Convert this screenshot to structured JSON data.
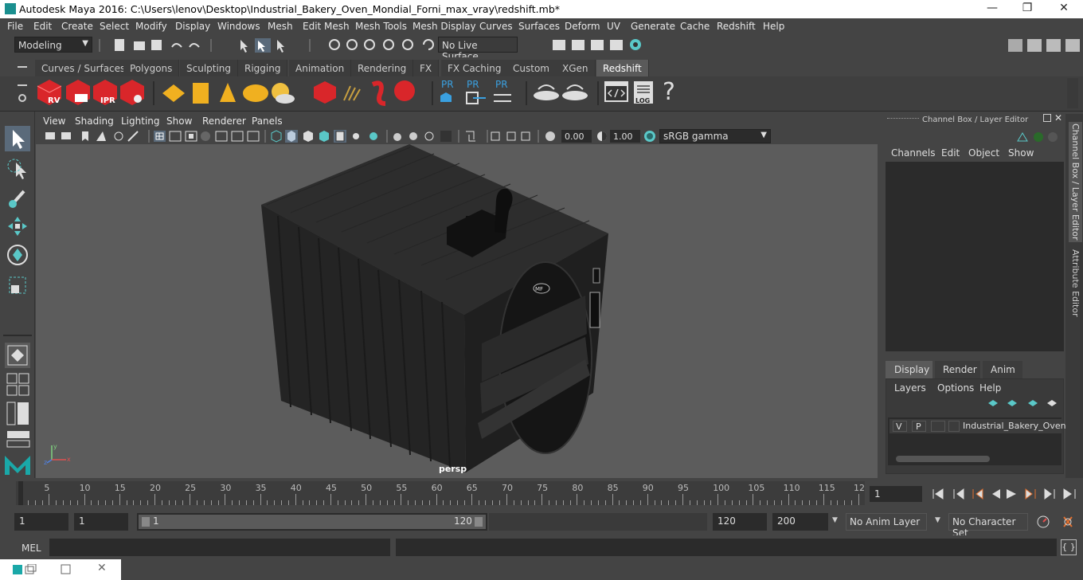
{
  "window": {
    "title": "Autodesk Maya 2016: C:\\Users\\lenov\\Desktop\\Industrial_Bakery_Oven_Mondial_Forni_max_vray\\redshift.mb*",
    "minimize": "—",
    "maximize": "❐",
    "close": "✕"
  },
  "menubar": [
    "File",
    "Edit",
    "Create",
    "Select",
    "Modify",
    "Display",
    "Windows",
    "Mesh",
    "Edit Mesh",
    "Mesh Tools",
    "Mesh Display",
    "Curves",
    "Surfaces",
    "Deform",
    "UV",
    "Generate",
    "Cache",
    "Redshift",
    "Help"
  ],
  "statusline": {
    "mode": "Modeling",
    "live_surface": "No Live Surface"
  },
  "shelf_tabs": [
    "Curves / Surfaces",
    "Polygons",
    "Sculpting",
    "Rigging",
    "Animation",
    "Rendering",
    "FX",
    "FX Caching",
    "Custom",
    "XGen",
    "Redshift"
  ],
  "active_shelf_tab": "Redshift",
  "shelf_icons": {
    "rv": "RV",
    "ipr": "IPR",
    "pr1": "PR",
    "pr2": "PR",
    "pr3": "PR",
    "log": "LOG",
    "question": "?"
  },
  "panel_menu": [
    "View",
    "Shading",
    "Lighting",
    "Show",
    "Renderer",
    "Panels"
  ],
  "panel_toolbar": {
    "exposure": "0.00",
    "gamma": "1.00",
    "color_space": "sRGB gamma"
  },
  "viewport": {
    "camera_label": "persp",
    "axis_y": "y",
    "axis_x": "x",
    "axis_z": "z",
    "logo_text": "MF"
  },
  "right_panel": {
    "header": "Channel Box / Layer Editor",
    "channel_menu": [
      "Channels",
      "Edit",
      "Object",
      "Show"
    ],
    "layer_tabs": [
      "Display",
      "Render",
      "Anim"
    ],
    "active_layer_tab": "Display",
    "layer_menu": [
      "Layers",
      "Options",
      "Help"
    ],
    "layer_row": {
      "v": "V",
      "p": "P",
      "name": "Industrial_Bakery_Oven_"
    }
  },
  "side_tabs": [
    "Channel Box / Layer Editor",
    "Attribute Editor"
  ],
  "time_slider": {
    "labels": [
      "5",
      "10",
      "15",
      "20",
      "25",
      "30",
      "35",
      "40",
      "45",
      "50",
      "55",
      "60",
      "65",
      "70",
      "75",
      "80",
      "85",
      "90",
      "95",
      "100",
      "105",
      "110",
      "115",
      "12"
    ],
    "start_label": "1",
    "current_frame": "1"
  },
  "range_slider": {
    "start_time": "1",
    "range_start": "1",
    "range_bar_start": "1",
    "range_bar_end": "120",
    "range_end": "120",
    "end_time": "200",
    "anim_layer": "No Anim Layer",
    "character_set": "No Character Set"
  },
  "command_line": {
    "label": "MEL"
  },
  "colors": {
    "accent": "#5ac8c8",
    "redshift_red": "#d9262a",
    "pr_blue": "#3aa0e0",
    "viewport_bg": "#5c5c5c"
  }
}
